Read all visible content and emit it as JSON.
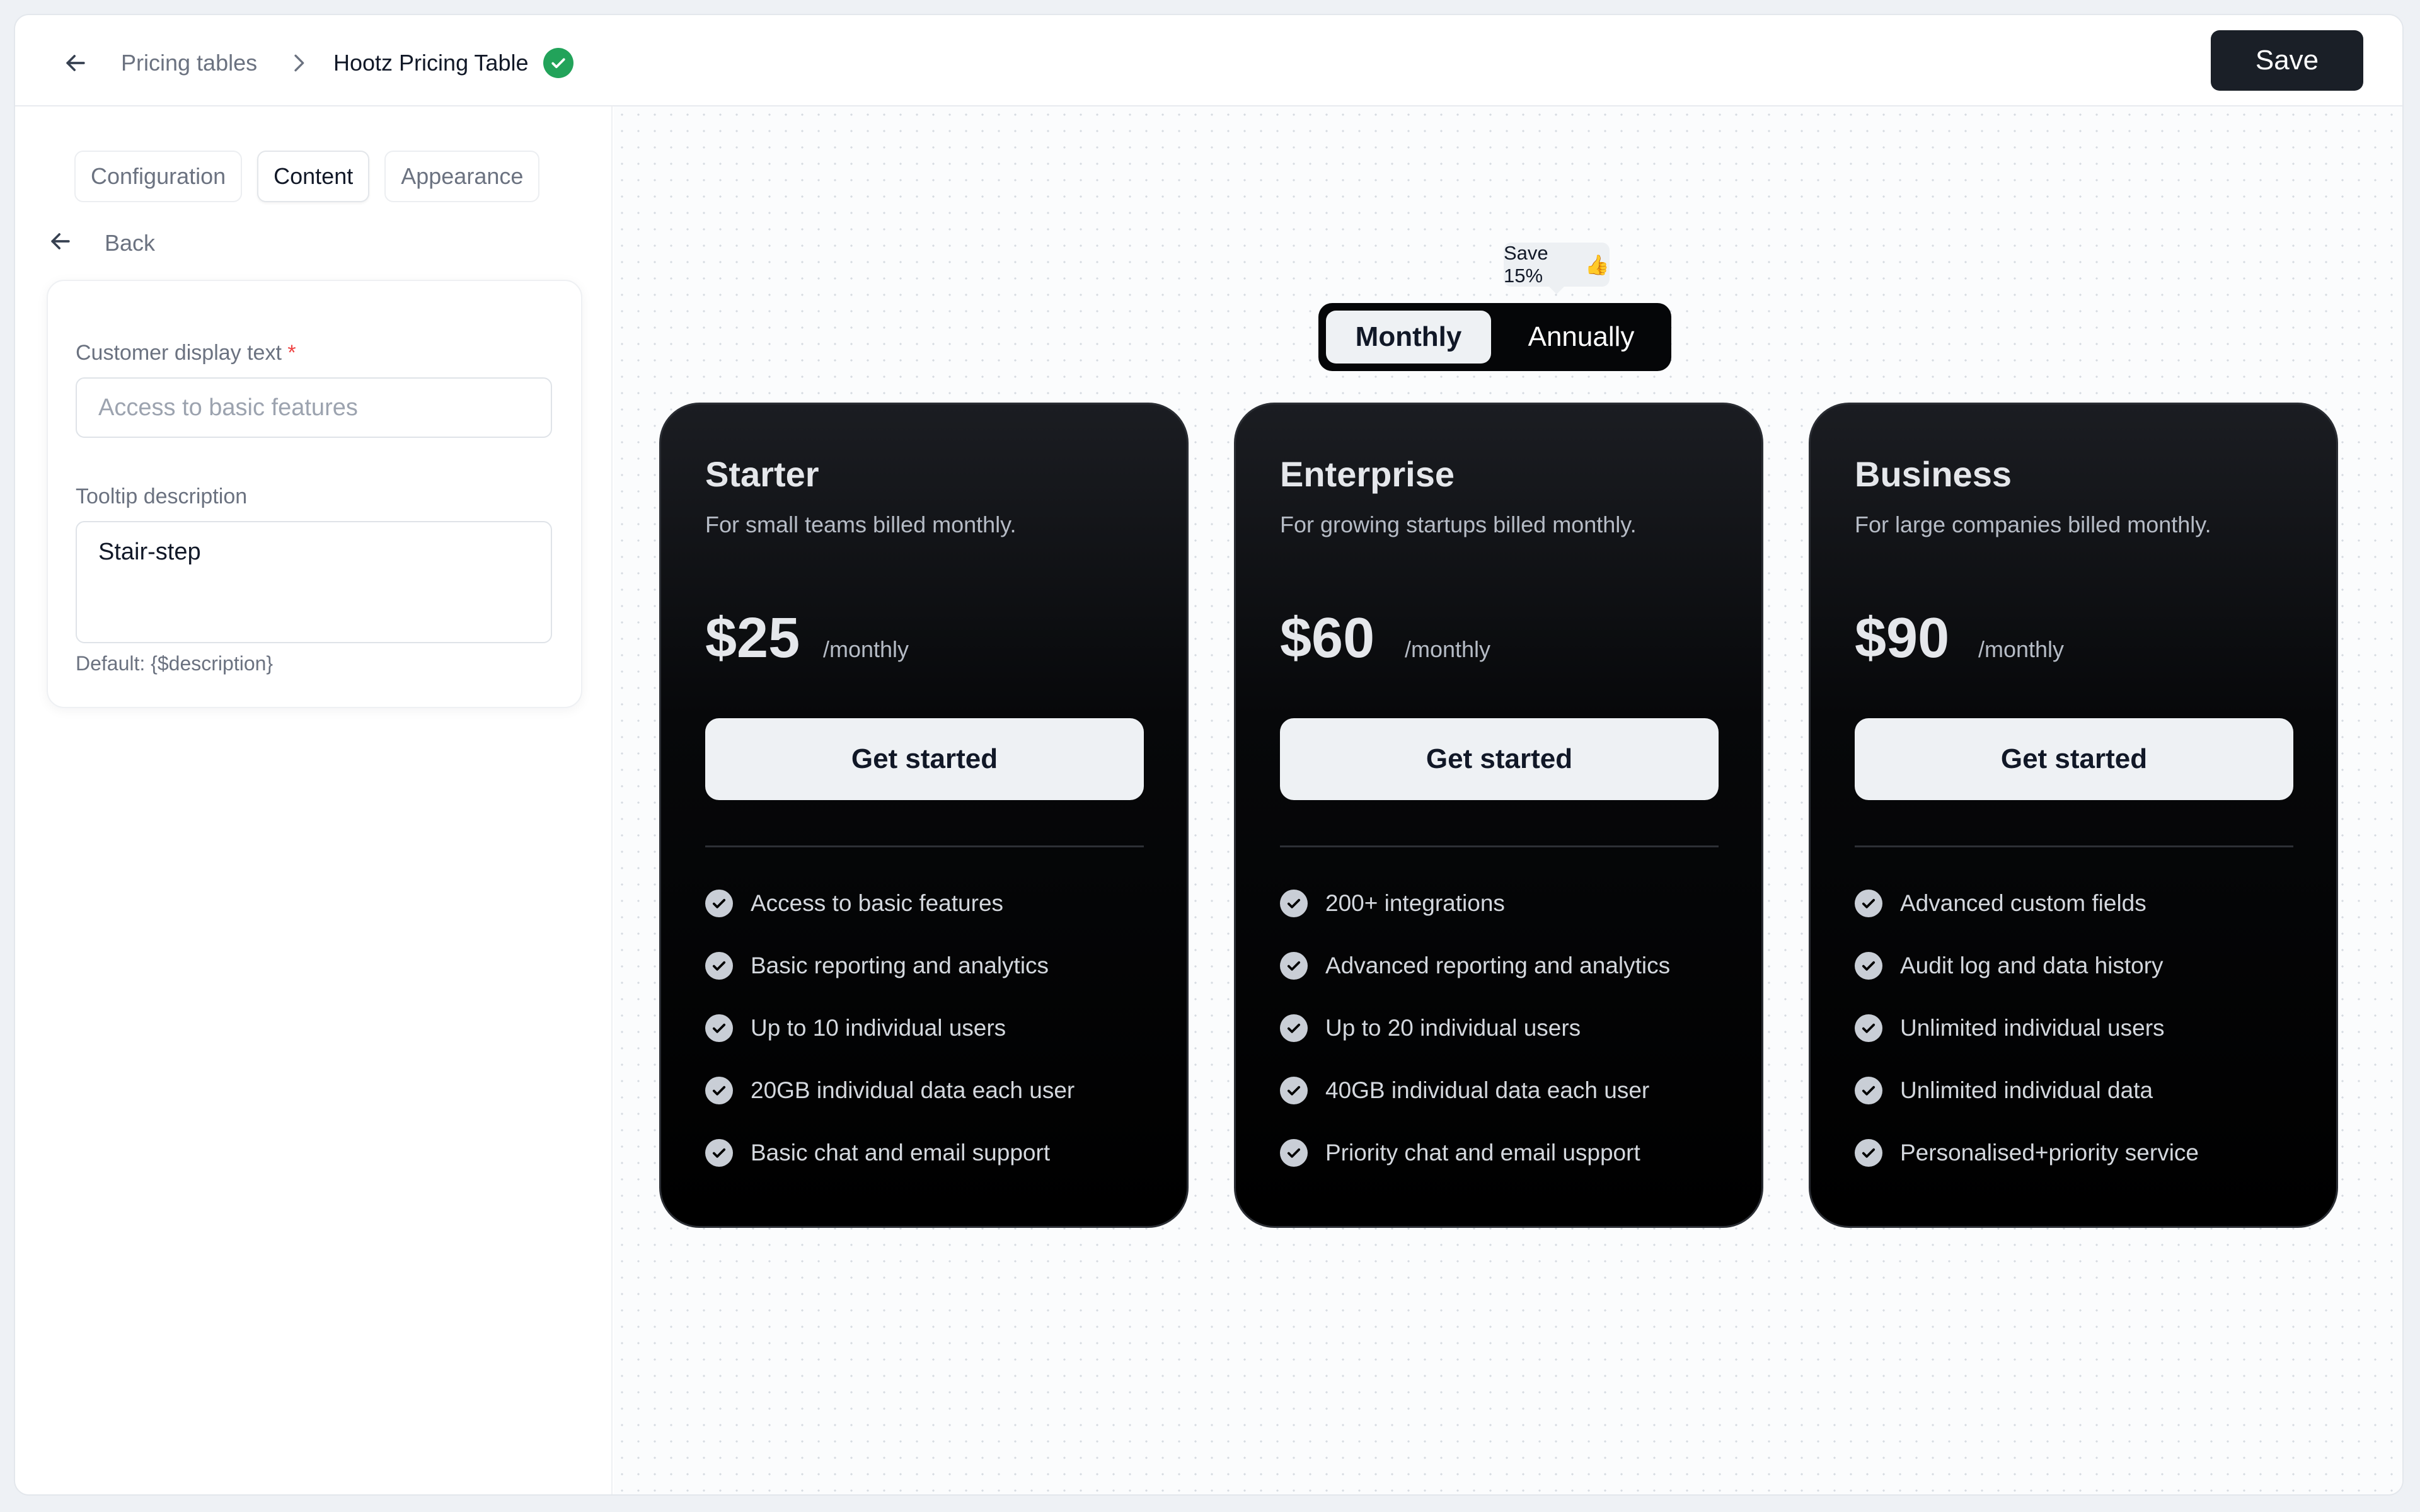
{
  "header": {
    "breadcrumb_parent": "Pricing tables",
    "breadcrumb_current": "Hootz Pricing Table",
    "save_label": "Save"
  },
  "sidebar": {
    "tabs": [
      {
        "label": "Configuration"
      },
      {
        "label": "Content"
      },
      {
        "label": "Appearance"
      }
    ],
    "active_tab": "Content",
    "back_label": "Back",
    "form": {
      "display_text_label": "Customer display text",
      "required_mark": "*",
      "display_text_placeholder": "Access to basic features",
      "display_text_value": "",
      "tooltip_label": "Tooltip description",
      "tooltip_value": "Stair-step",
      "hint": "Default: {$description}"
    }
  },
  "canvas": {
    "save_pill": "Save 15%",
    "save_pill_emoji": "👍",
    "toggle": {
      "monthly": "Monthly",
      "annually": "Annually",
      "selected": "Monthly"
    },
    "plans": [
      {
        "name": "Starter",
        "subtitle": "For small teams billed monthly.",
        "price": "$25",
        "period": "/monthly",
        "cta": "Get started",
        "features": [
          "Access to basic features",
          "Basic reporting and analytics",
          "Up to 10 individual users",
          "20GB individual data each user",
          "Basic chat and email support"
        ]
      },
      {
        "name": "Enterprise",
        "subtitle": "For growing startups billed monthly.",
        "price": "$60",
        "period": "/monthly",
        "cta": "Get started",
        "features": [
          "200+ integrations",
          "Advanced reporting and analytics",
          "Up to 20 individual users",
          "40GB individual data each user",
          "Priority chat and email uspport"
        ]
      },
      {
        "name": "Business",
        "subtitle": "For large companies billed monthly.",
        "price": "$90",
        "period": "/monthly",
        "cta": "Get started",
        "features": [
          "Advanced custom fields",
          "Audit log and data history",
          "Unlimited individual users",
          "Unlimited individual data",
          "Personalised+priority service"
        ]
      }
    ]
  },
  "colors": {
    "save_button": "#1a1f27",
    "verified_badge": "#22a35a",
    "required": "#ef4444",
    "card_bg": "#000000"
  },
  "icons": {
    "back": "arrow-left-icon",
    "breadcrumb_separator": "chevron-right-icon",
    "verified": "check-circle-icon",
    "feature": "check-circle-icon"
  }
}
